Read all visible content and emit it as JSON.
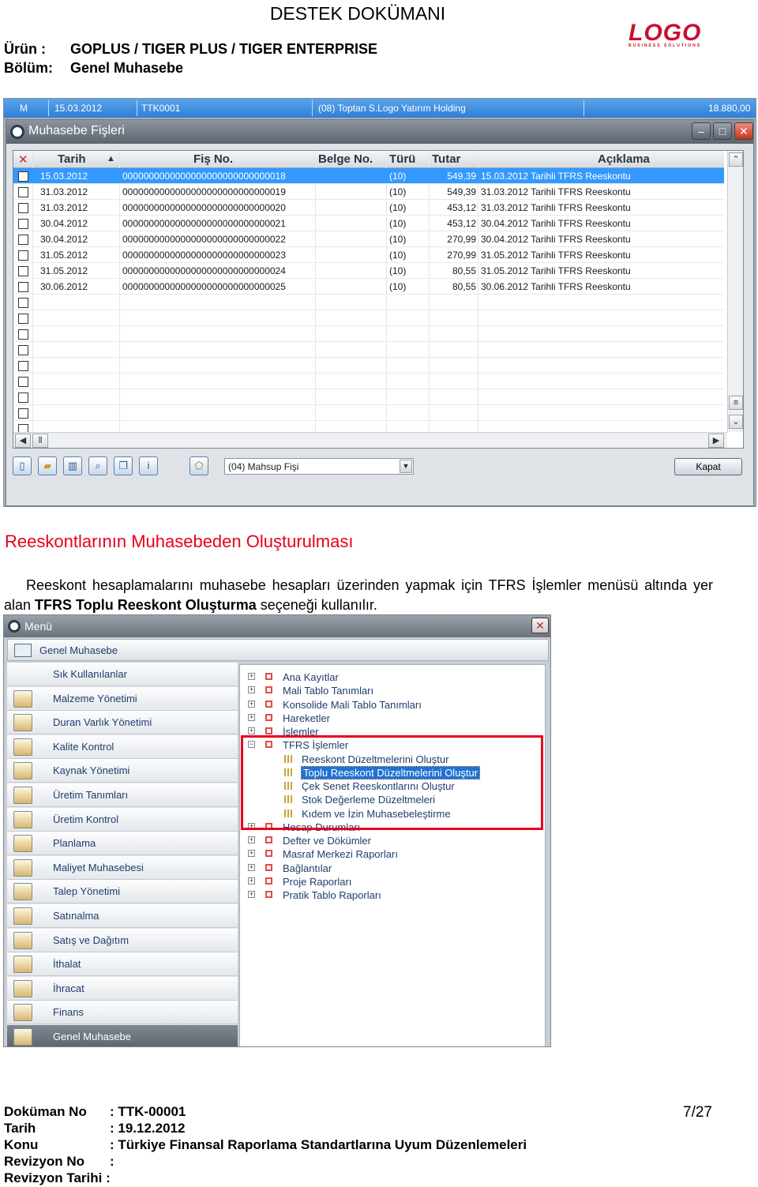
{
  "header": {
    "doc_title": "DESTEK DOKÜMANI",
    "product_label": "Ürün :",
    "product_value": "GOPLUS / TIGER PLUS / TIGER ENTERPRISE",
    "section_label": "Bölüm:",
    "section_value": "Genel Muhasebe",
    "logo_text": "LOGO",
    "logo_subtext": "BUSINESS SOLUTIONS",
    "logo_color": "#c8102e"
  },
  "screenshot1": {
    "taskbar": {
      "m": "M",
      "date": "15.03.2012",
      "code": "TTK0001",
      "company": "(08) Toptan S.Logo Yatırım Holding",
      "amount": "18.880,00"
    },
    "window_title": "Muhasebe Fişleri",
    "columns": [
      "Tarih",
      "Fiş No.",
      "Belge No.",
      "Türü",
      "Tutar",
      "Açıklama"
    ],
    "rows": [
      {
        "date": "15.03.2012",
        "fis": "0000000000000000000000000000018",
        "type": "(10)",
        "amount": "549,39",
        "desc": "15.03.2012 Tarihli TFRS Reeskontu"
      },
      {
        "date": "31.03.2012",
        "fis": "0000000000000000000000000000019",
        "type": "(10)",
        "amount": "549,39",
        "desc": "31.03.2012 Tarihli TFRS Reeskontu"
      },
      {
        "date": "31.03.2012",
        "fis": "0000000000000000000000000000020",
        "type": "(10)",
        "amount": "453,12",
        "desc": "31.03.2012 Tarihli TFRS Reeskontu"
      },
      {
        "date": "30.04.2012",
        "fis": "0000000000000000000000000000021",
        "type": "(10)",
        "amount": "453,12",
        "desc": "30.04.2012 Tarihli TFRS Reeskontu"
      },
      {
        "date": "30.04.2012",
        "fis": "0000000000000000000000000000022",
        "type": "(10)",
        "amount": "270,99",
        "desc": "30.04.2012 Tarihli TFRS Reeskontu"
      },
      {
        "date": "31.05.2012",
        "fis": "0000000000000000000000000000023",
        "type": "(10)",
        "amount": "270,99",
        "desc": "31.05.2012 Tarihli TFRS Reeskontu"
      },
      {
        "date": "31.05.2012",
        "fis": "0000000000000000000000000000024",
        "type": "(10)",
        "amount": "80,55",
        "desc": "31.05.2012 Tarihli TFRS Reeskontu"
      },
      {
        "date": "30.06.2012",
        "fis": "0000000000000000000000000000025",
        "type": "(10)",
        "amount": "80,55",
        "desc": "30.06.2012 Tarihli TFRS Reeskontu"
      }
    ],
    "fis_type_select": "(04) Mahsup Fişi",
    "close_button": "Kapat",
    "selected_row_color": "#3399ff"
  },
  "section": {
    "title": "Reeskontlarının Muhasebeden Oluşturulması",
    "title_color": "#e8001c",
    "para_before": "Reeskont hesaplamalarını muhasebe hesapları üzerinden yapmak için TFRS İşlemler menüsü altında yer alan ",
    "para_bold": "TFRS Toplu Reeskont Oluşturma",
    "para_after": " seçeneği kullanılır."
  },
  "screenshot2": {
    "window_title": "Menü",
    "header_item": "Genel Muhasebe",
    "left_items": [
      "Sık Kullanılanlar",
      "Malzeme Yönetimi",
      "Duran Varlık Yönetimi",
      "Kalite Kontrol",
      "Kaynak Yönetimi",
      "Üretim Tanımları",
      "Üretim Kontrol",
      "Planlama",
      "Maliyet Muhasebesi",
      "Talep Yönetimi",
      "Satınalma",
      "Satış ve Dağıtım",
      "İthalat",
      "İhracat",
      "Finans",
      "Genel Muhasebe"
    ],
    "tree_top": [
      "Ana Kayıtlar",
      "Mali Tablo Tanımları",
      "Konsolide Mali Tablo Tanımları",
      "Hareketler",
      "İşlemler"
    ],
    "tree_tfrs": "TFRS İşlemler",
    "tree_tfrs_children": [
      "Reeskont Düzeltmelerini Oluştur",
      "Toplu Reeskont Düzeltmelerini Oluştur",
      "Çek Senet Reeskontlarını Oluştur",
      "Stok Değerleme Düzeltmeleri",
      "Kıdem ve İzin Muhasebeleştirme"
    ],
    "tree_bottom": [
      "Hesap Durumları",
      "Defter ve Dökümler",
      "Masraf Merkezi Raporları",
      "Bağlantılar",
      "Proje Raporları",
      "Pratik Tablo Raporları"
    ],
    "highlight_color": "#e8001c"
  },
  "footer": {
    "doc_no_label": "Doküman No",
    "doc_no_value": ":  TTK-00001",
    "date_label": "Tarih",
    "date_value": ": 19.12.2012",
    "subject_label": "Konu",
    "subject_value": ": Türkiye Finansal Raporlama Standartlarına Uyum Düzenlemeleri",
    "rev_label": "Revizyon No",
    "rev_value": ":",
    "rev_date_label": "Revizyon Tarihi :",
    "page": "7/27"
  }
}
